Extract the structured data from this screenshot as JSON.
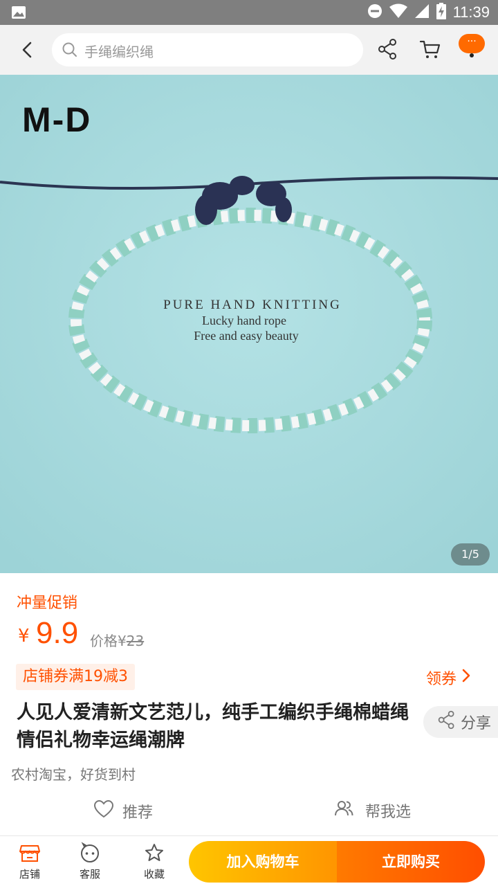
{
  "status_bar": {
    "time": "11:39",
    "icons": [
      "image-icon",
      "dnd-icon",
      "wifi-icon",
      "signal-icon",
      "battery-icon"
    ]
  },
  "topnav": {
    "search_placeholder": "手绳编织绳",
    "icons": [
      "back-icon",
      "search-icon",
      "share-icon",
      "cart-icon",
      "more-icon"
    ],
    "more_label": "···"
  },
  "hero": {
    "brand": "M-D",
    "line1": "PURE HAND KNITTING",
    "line2": "Lucky hand rope",
    "line3": "Free and easy beauty",
    "pager": "1/5"
  },
  "product": {
    "promo_tag": "冲量促销",
    "currency": "¥",
    "price": "9.9",
    "orig_label": "价格",
    "orig_currency": "¥",
    "orig_price": "23",
    "coupon": "店铺券满19减3",
    "get_coupon": "领券",
    "title": "人见人爱清新文艺范儿，纯手工编织手绳棉蜡绳情侣礼物幸运绳潮牌",
    "share": "分享",
    "slogan": "农村淘宝，好货到村",
    "recommend": "推荐",
    "help_choose": "帮我选"
  },
  "bottom_bar": {
    "shop": "店铺",
    "service": "客服",
    "favorite": "收藏",
    "add_cart": "加入购物车",
    "buy_now": "立即购买"
  },
  "colors": {
    "accent": "#ff5000",
    "cart_btn": "#ffb400",
    "buy_btn": "#ff6a00",
    "hero_bg": "#a9dbdf"
  }
}
